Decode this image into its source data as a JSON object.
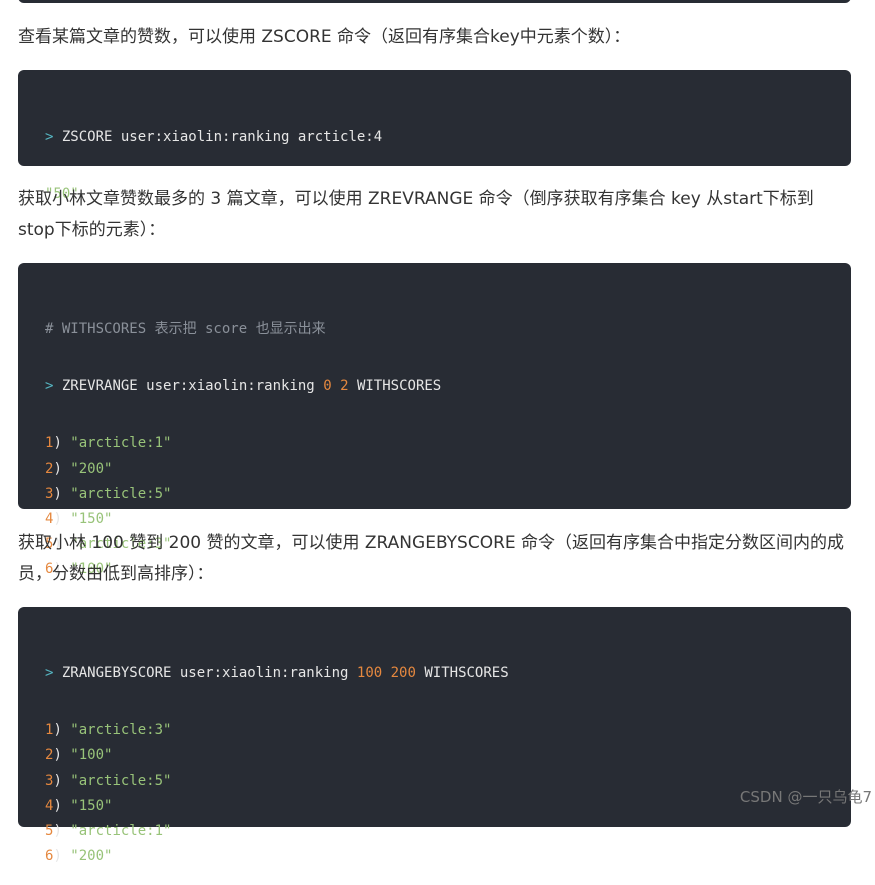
{
  "paragraphs": {
    "p1": "查看某篇文章的赞数，可以使用 ZSCORE 命令（返回有序集合key中元素个数）：",
    "p2": "获取小林文章赞数最多的 3 篇文章，可以使用 ZREVRANGE 命令（倒序获取有序集合 key 从start下标到stop下标的元素）：",
    "p3": "获取小林 100 赞到 200 赞的文章，可以使用 ZRANGEBYSCORE 命令（返回有序集合中指定分数区间内的成员，分数由低到高排序）："
  },
  "code1": {
    "prompt": ">",
    "cmd": "ZSCORE user:xiaolin:ranking arcticle:4",
    "result": "\"50\""
  },
  "code2": {
    "comment": "# WITHSCORES 表示把 score 也显示出来",
    "prompt": ">",
    "cmd": "ZREVRANGE user:xiaolin:ranking",
    "arg1": "0",
    "arg2": "2",
    "flag": "WITHSCORES",
    "results": [
      {
        "idx": "1",
        "val": "\"arcticle:1\""
      },
      {
        "idx": "2",
        "val": "\"200\""
      },
      {
        "idx": "3",
        "val": "\"arcticle:5\""
      },
      {
        "idx": "4",
        "val": "\"150\""
      },
      {
        "idx": "5",
        "val": "\"arcticle:3\""
      },
      {
        "idx": "6",
        "val": "\"100\""
      }
    ]
  },
  "code3": {
    "prompt": ">",
    "cmd": "ZRANGEBYSCORE user:xiaolin:ranking",
    "arg1": "100",
    "arg2": "200",
    "flag": "WITHSCORES",
    "results": [
      {
        "idx": "1",
        "val": "\"arcticle:3\""
      },
      {
        "idx": "2",
        "val": "\"100\""
      },
      {
        "idx": "3",
        "val": "\"arcticle:5\""
      },
      {
        "idx": "4",
        "val": "\"150\""
      },
      {
        "idx": "5",
        "val": "\"arcticle:1\""
      },
      {
        "idx": "6",
        "val": "\"200\""
      }
    ]
  },
  "watermark": "CSDN @一只乌龟7"
}
